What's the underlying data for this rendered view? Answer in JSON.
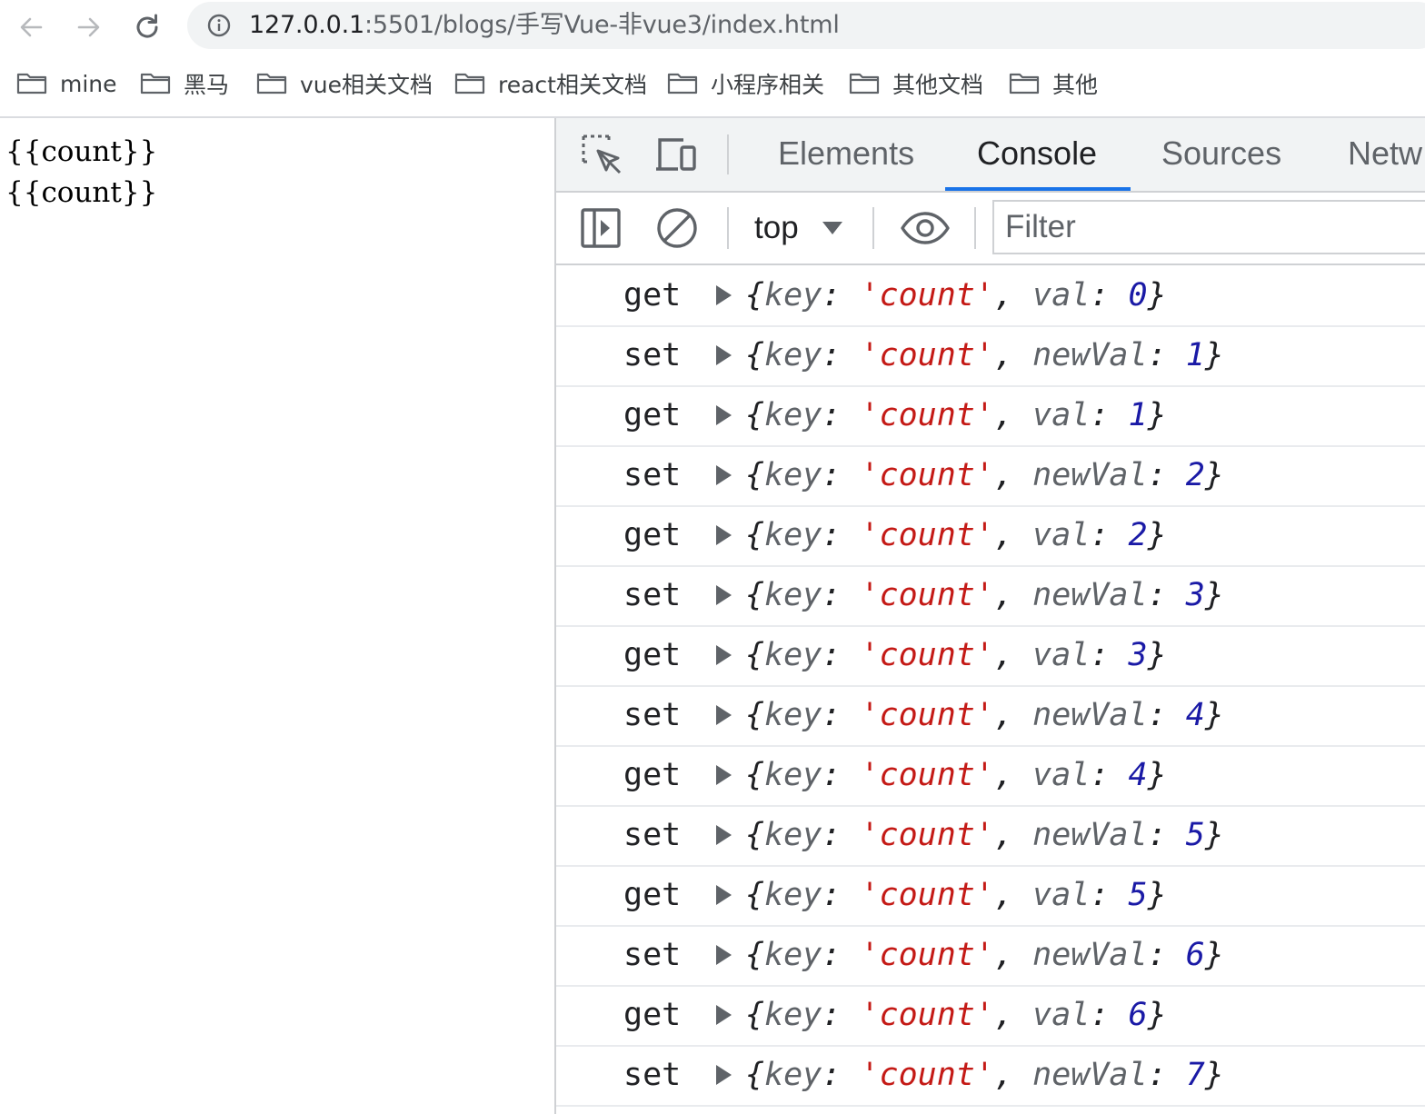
{
  "browser": {
    "url_host": "127.0.0.1",
    "url_rest": ":5501/blogs/手写Vue-非vue3/index.html",
    "nav": [
      "back-icon",
      "forward-icon",
      "reload-icon"
    ],
    "info_icon": "info-icon"
  },
  "bookmarks": [
    {
      "label": "mine"
    },
    {
      "label": "黑马"
    },
    {
      "label": "vue相关文档"
    },
    {
      "label": "react相关文档"
    },
    {
      "label": "小程序相关"
    },
    {
      "label": "其他文档"
    },
    {
      "label": "其他"
    }
  ],
  "page": {
    "lines": [
      "{{count}}",
      "{{count}}"
    ]
  },
  "devtools": {
    "tabs": [
      "Elements",
      "Console",
      "Sources",
      "Netw"
    ],
    "active_tab": "Console",
    "context": "top",
    "filter_placeholder": "Filter",
    "colors": {
      "accent": "#1a73e8",
      "string": "#c41a16",
      "number": "#1a1aa6",
      "key": "#5f6368"
    }
  },
  "console": {
    "logs": [
      {
        "level": "get",
        "key_label": "key",
        "key_value": "'count'",
        "val_label": "val",
        "value": "0"
      },
      {
        "level": "set",
        "key_label": "key",
        "key_value": "'count'",
        "val_label": "newVal",
        "value": "1"
      },
      {
        "level": "get",
        "key_label": "key",
        "key_value": "'count'",
        "val_label": "val",
        "value": "1"
      },
      {
        "level": "set",
        "key_label": "key",
        "key_value": "'count'",
        "val_label": "newVal",
        "value": "2"
      },
      {
        "level": "get",
        "key_label": "key",
        "key_value": "'count'",
        "val_label": "val",
        "value": "2"
      },
      {
        "level": "set",
        "key_label": "key",
        "key_value": "'count'",
        "val_label": "newVal",
        "value": "3"
      },
      {
        "level": "get",
        "key_label": "key",
        "key_value": "'count'",
        "val_label": "val",
        "value": "3"
      },
      {
        "level": "set",
        "key_label": "key",
        "key_value": "'count'",
        "val_label": "newVal",
        "value": "4"
      },
      {
        "level": "get",
        "key_label": "key",
        "key_value": "'count'",
        "val_label": "val",
        "value": "4"
      },
      {
        "level": "set",
        "key_label": "key",
        "key_value": "'count'",
        "val_label": "newVal",
        "value": "5"
      },
      {
        "level": "get",
        "key_label": "key",
        "key_value": "'count'",
        "val_label": "val",
        "value": "5"
      },
      {
        "level": "set",
        "key_label": "key",
        "key_value": "'count'",
        "val_label": "newVal",
        "value": "6"
      },
      {
        "level": "get",
        "key_label": "key",
        "key_value": "'count'",
        "val_label": "val",
        "value": "6"
      },
      {
        "level": "set",
        "key_label": "key",
        "key_value": "'count'",
        "val_label": "newVal",
        "value": "7"
      }
    ]
  }
}
